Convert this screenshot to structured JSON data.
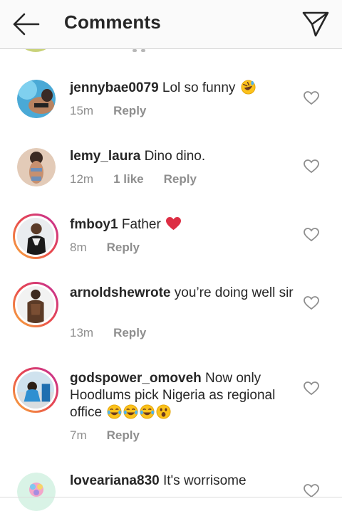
{
  "header": {
    "title": "Comments",
    "back_icon": "arrow-left-icon",
    "send_icon": "paper-plane-icon"
  },
  "comments": [
    {
      "username": "jennybae0079",
      "text": "Lol so funny",
      "time": "15m",
      "likes": "",
      "reply": "Reply",
      "emojis": [
        "rofl"
      ]
    },
    {
      "username": "lemy_laura",
      "text": "Dino dino.",
      "time": "12m",
      "likes": "1 like",
      "reply": "Reply",
      "emojis": []
    },
    {
      "username": "fmboy1",
      "text": "Father",
      "time": "8m",
      "likes": "",
      "reply": "Reply",
      "emojis": [
        "red-heart"
      ]
    },
    {
      "username": "arnoldshewrote",
      "text": "you’re doing well sir",
      "time": "13m",
      "likes": "",
      "reply": "Reply",
      "emojis": []
    },
    {
      "username": "godspower_omoveh",
      "text": "Now only Hoodlums pick Nigeria as regional office",
      "time": "7m",
      "likes": "",
      "reply": "Reply",
      "emojis": [
        "tears-of-joy",
        "tears-of-joy",
        "tears-of-joy",
        "astonished"
      ]
    },
    {
      "username": "loveariana830",
      "text": "It's worrisome",
      "time": "",
      "likes": "",
      "reply": "",
      "emojis": []
    }
  ],
  "colors": {
    "text": "#262626",
    "muted": "#8e8e8e",
    "heart_outline": "#8e8e8e",
    "story_ring": "#e8484d"
  }
}
